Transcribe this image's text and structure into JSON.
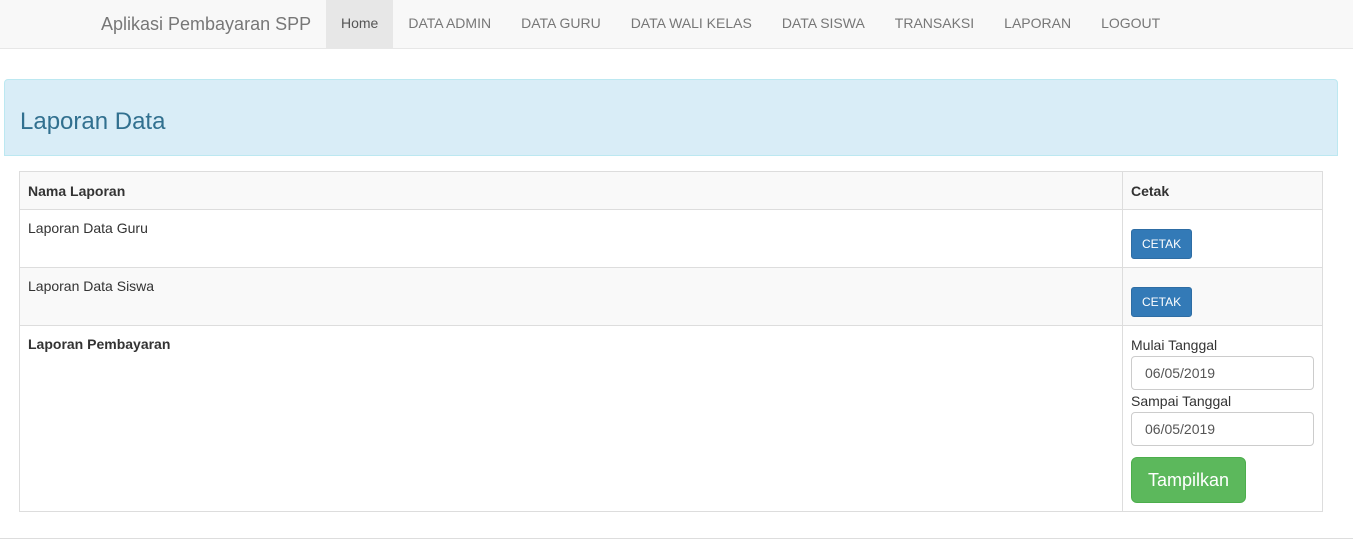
{
  "navbar": {
    "brand": "Aplikasi Pembayaran SPP",
    "items": [
      {
        "label": "Home",
        "active": true
      },
      {
        "label": "DATA ADMIN"
      },
      {
        "label": "DATA GURU"
      },
      {
        "label": "DATA WALI KELAS"
      },
      {
        "label": "DATA SISWA"
      },
      {
        "label": "TRANSAKSI"
      },
      {
        "label": "LAPORAN"
      },
      {
        "label": "LOGOUT"
      }
    ]
  },
  "panel": {
    "title": "Laporan Data"
  },
  "table": {
    "headers": [
      "Nama Laporan",
      "Cetak"
    ],
    "rows": [
      {
        "name": "Laporan Data Guru",
        "button": "CETAK"
      },
      {
        "name": "Laporan Data Siswa",
        "button": "CETAK"
      },
      {
        "name": "Laporan Pembayaran"
      }
    ]
  },
  "payment_form": {
    "start_label": "Mulai Tanggal",
    "start_value": "06/05/2019",
    "end_label": "Sampai Tanggal",
    "end_value": "06/05/2019",
    "submit_label": "Tampilkan"
  },
  "colors": {
    "primary": "#337ab7",
    "success": "#5cb85c",
    "panel_info_bg": "#d9edf7",
    "panel_info_text": "#31708f"
  }
}
